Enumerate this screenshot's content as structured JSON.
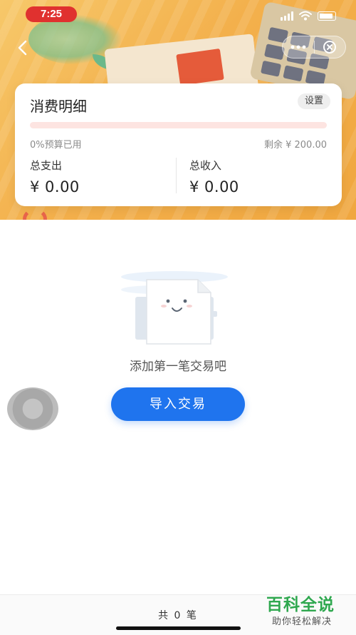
{
  "status_bar": {
    "time": "7:25"
  },
  "nav": {
    "back_icon": "chevron-left-icon",
    "more_icon": "more-dots-icon",
    "close_icon": "close-circle-icon"
  },
  "summary_card": {
    "title": "消费明细",
    "settings_label": "设置",
    "budget_used_fraction": 0,
    "budget_used_text": "0%预算已用",
    "budget_remaining_text": "剩余 ¥ 200.00",
    "total_expense_label": "总支出",
    "total_expense_value": "¥ 0.00",
    "total_income_label": "总收入",
    "total_income_value": "¥ 0.00"
  },
  "empty_state": {
    "message": "添加第一笔交易吧",
    "button_label": "导入交易"
  },
  "footer": {
    "record_count": "共 0 笔"
  },
  "watermark": {
    "title": "百科全说",
    "subtitle": "助你轻松解决"
  },
  "colors": {
    "primary": "#1f74ee",
    "budget_bar": "#fde4e1",
    "header_bg": "#f3b04c",
    "status_time_bg": "#e0312f",
    "watermark_green": "#2fa84f"
  }
}
